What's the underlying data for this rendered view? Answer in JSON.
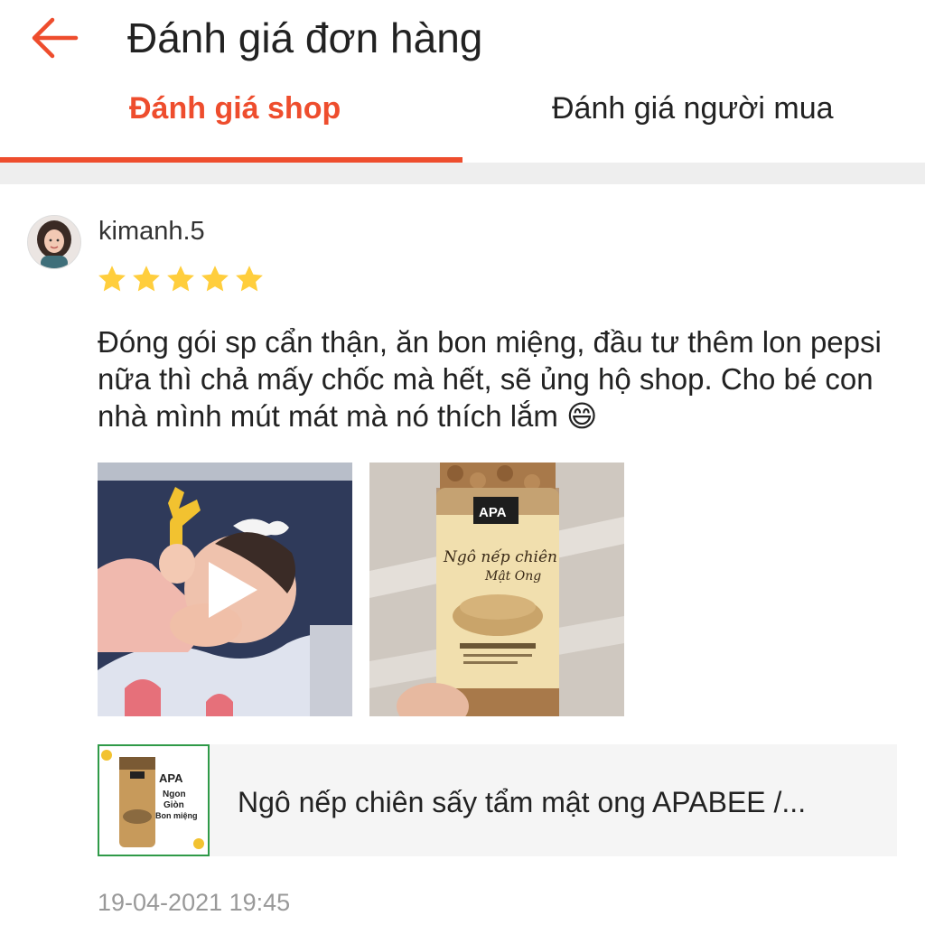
{
  "header": {
    "back_icon": "arrow-left-icon",
    "title": "Đánh giá đơn hàng"
  },
  "tabs": [
    {
      "label": "Đánh giá shop",
      "active": true
    },
    {
      "label": "Đánh giá người mua",
      "active": false
    }
  ],
  "review": {
    "username": "kimanh.5",
    "rating": 5,
    "rating_max": 5,
    "comment": "Đóng gói sp cẩn thận, ăn bon miệng, đầu tư thêm lon pepsi nữa thì chả mấy chốc mà hết, sẽ ủng hộ shop. Cho bé con nhà mình mút mát mà nó thích lắm 😄",
    "media": [
      {
        "type": "video",
        "icon": "play-icon"
      },
      {
        "type": "photo",
        "product_label": "APA"
      }
    ],
    "product": {
      "name": "Ngô nếp chiên sấy tẩm mật ong APABEE /...",
      "thumb_texts": [
        "APA",
        "Ngon",
        "Giòn",
        "Bon miệng"
      ]
    },
    "timestamp": "19-04-2021 19:45"
  },
  "colors": {
    "accent": "#ee4d2d",
    "star": "#ffce3d",
    "divider": "#eeeeee",
    "muted_text": "#999999"
  }
}
